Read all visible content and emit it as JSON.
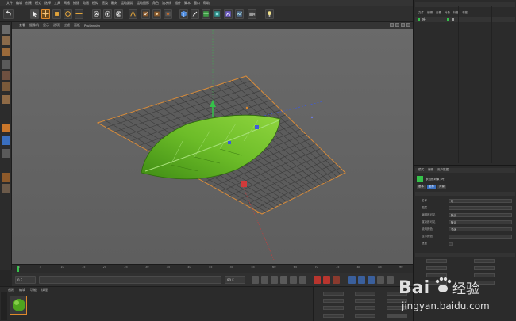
{
  "app": {
    "name": "CINEMA 4D"
  },
  "viewport": {
    "label": "Perspective",
    "menu": [
      "查看",
      "摄像机",
      "显示",
      "选项",
      "过滤",
      "面板",
      "ProRender"
    ]
  },
  "timeline": {
    "ticks": [
      "0",
      "5",
      "10",
      "15",
      "20",
      "25",
      "30",
      "35",
      "40",
      "45",
      "50",
      "55",
      "60",
      "65",
      "70",
      "75",
      "80",
      "85",
      "90"
    ],
    "current_frame": "0 F",
    "end_frame": "90 F"
  },
  "material_panel": {
    "menu": [
      "创建",
      "编辑",
      "功能",
      "纹理"
    ]
  },
  "object_manager": {
    "object_label": "叶"
  },
  "attribute_manager": {
    "tabs": [
      "基本",
      "坐标",
      "对象"
    ],
    "title": "多边形对象 [叶]",
    "rows": [
      "名称",
      "图层",
      "编辑器可见",
      "渲染器可见",
      "使用颜色",
      "显示颜色",
      "透显"
    ],
    "name_value": "叶",
    "visibility_value": "默认",
    "color_value": "关闭"
  },
  "coords": {
    "x": "0 cm",
    "y": "0 cm",
    "z": "0 cm",
    "h": "0°",
    "p": "0°",
    "b": "0°"
  },
  "watermark": {
    "brand": "Bai",
    "brand_suffix": "经验",
    "url": "jingyan.baidu.com"
  },
  "icons": {
    "move": "move-icon",
    "scale": "scale-icon",
    "rotate": "rotate-icon",
    "x_axis": "x-axis-icon",
    "y_axis": "y-axis-icon",
    "z_axis": "z-axis-icon",
    "render": "render-icon",
    "cube": "cube-icon"
  },
  "colors": {
    "grid_line": "#3c3c3c",
    "grid_border": "#d98c3a",
    "leaf_light": "#8fd53e",
    "leaf_dark": "#3f8c14",
    "axis_x": "#d23a3a",
    "axis_y": "#35c24a",
    "axis_z": "#3f5bdc",
    "accent_orange": "#e08a2c"
  }
}
